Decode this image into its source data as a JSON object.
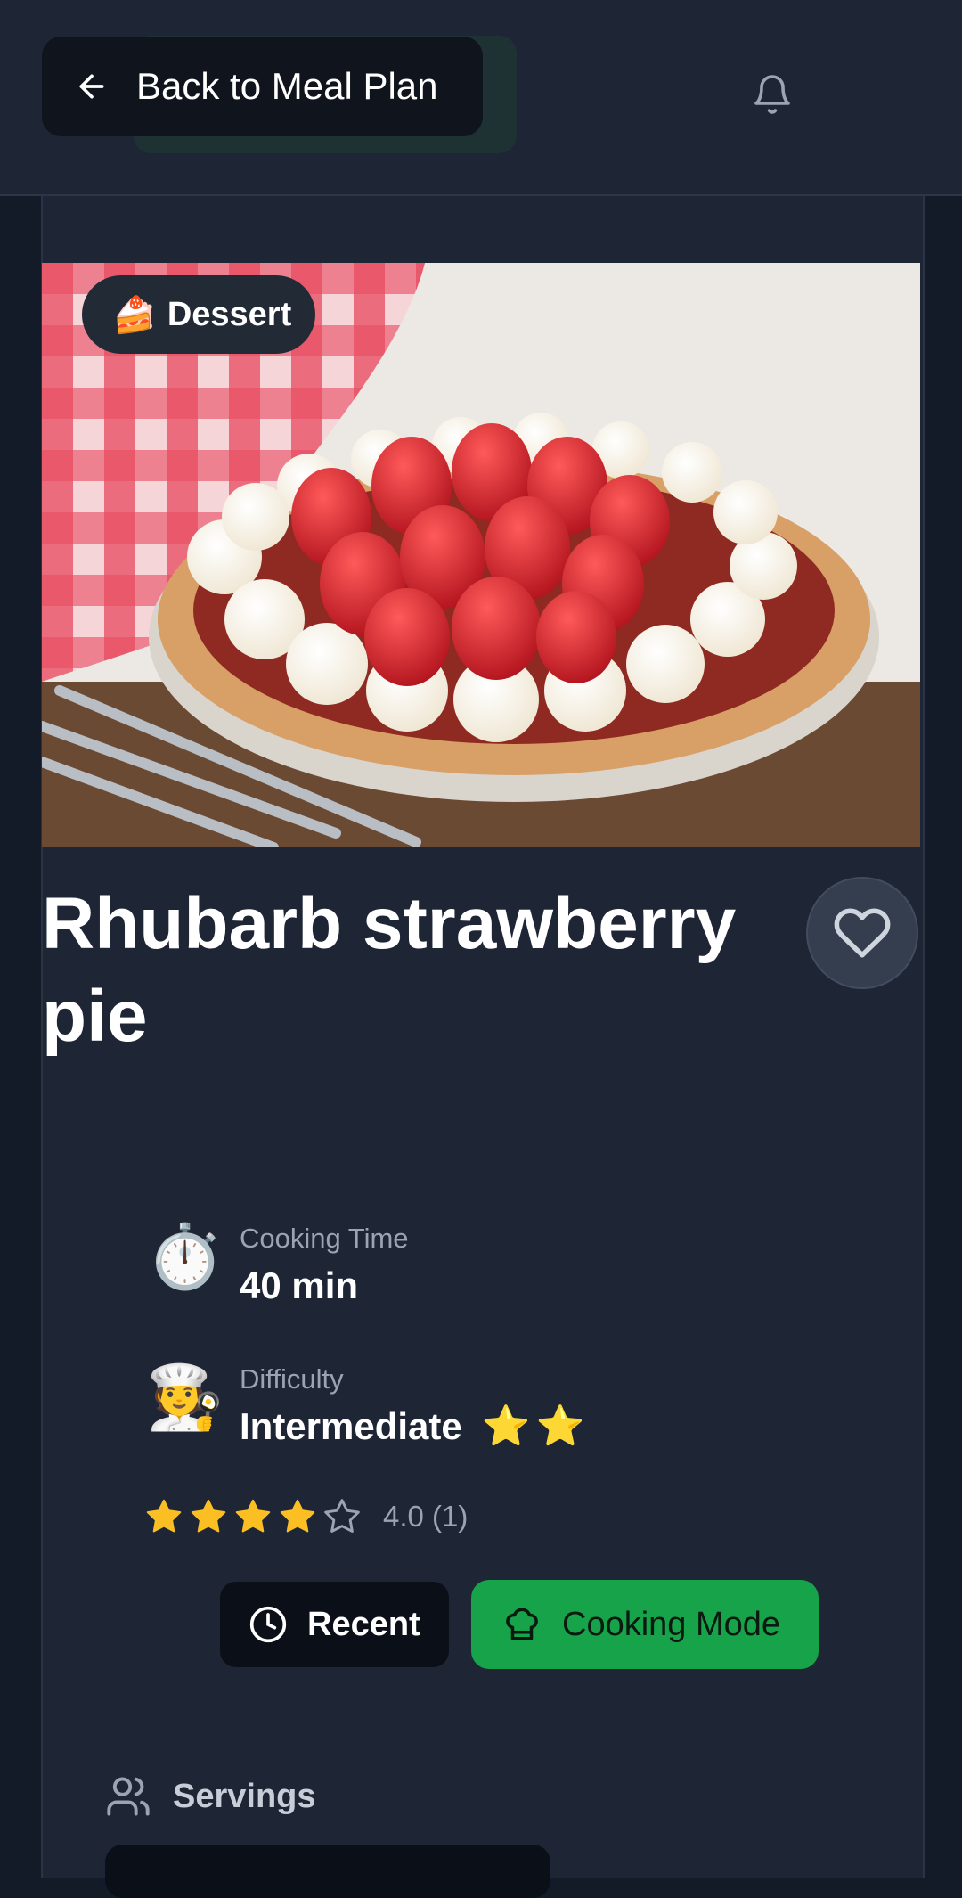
{
  "header": {
    "back_label": "Back to Meal Plan"
  },
  "recipe": {
    "category_emoji": "🍰",
    "category": "Dessert",
    "title": "Rhubarb strawberry pie",
    "cooking_time_label": "Cooking Time",
    "cooking_time_value": "40 min",
    "cooking_time_emoji": "⏱️",
    "difficulty_label": "Difficulty",
    "difficulty_value": "Intermediate",
    "difficulty_emoji": "🧑‍🍳",
    "difficulty_stars": "⭐⭐",
    "rating_value": 4,
    "rating_max": 5,
    "rating_text": "4.0 (1)"
  },
  "actions": {
    "recent_label": "Recent",
    "cooking_mode_label": "Cooking Mode"
  },
  "servings": {
    "label": "Servings"
  },
  "colors": {
    "background": "#131a28",
    "panel": "#1e2636",
    "accent_green": "#16a34a",
    "star_yellow": "#fbbf24"
  },
  "icons": [
    "arrow-left-icon",
    "bell-icon",
    "heart-icon",
    "star-icon",
    "clock-icon",
    "chef-hat-icon",
    "users-icon"
  ]
}
